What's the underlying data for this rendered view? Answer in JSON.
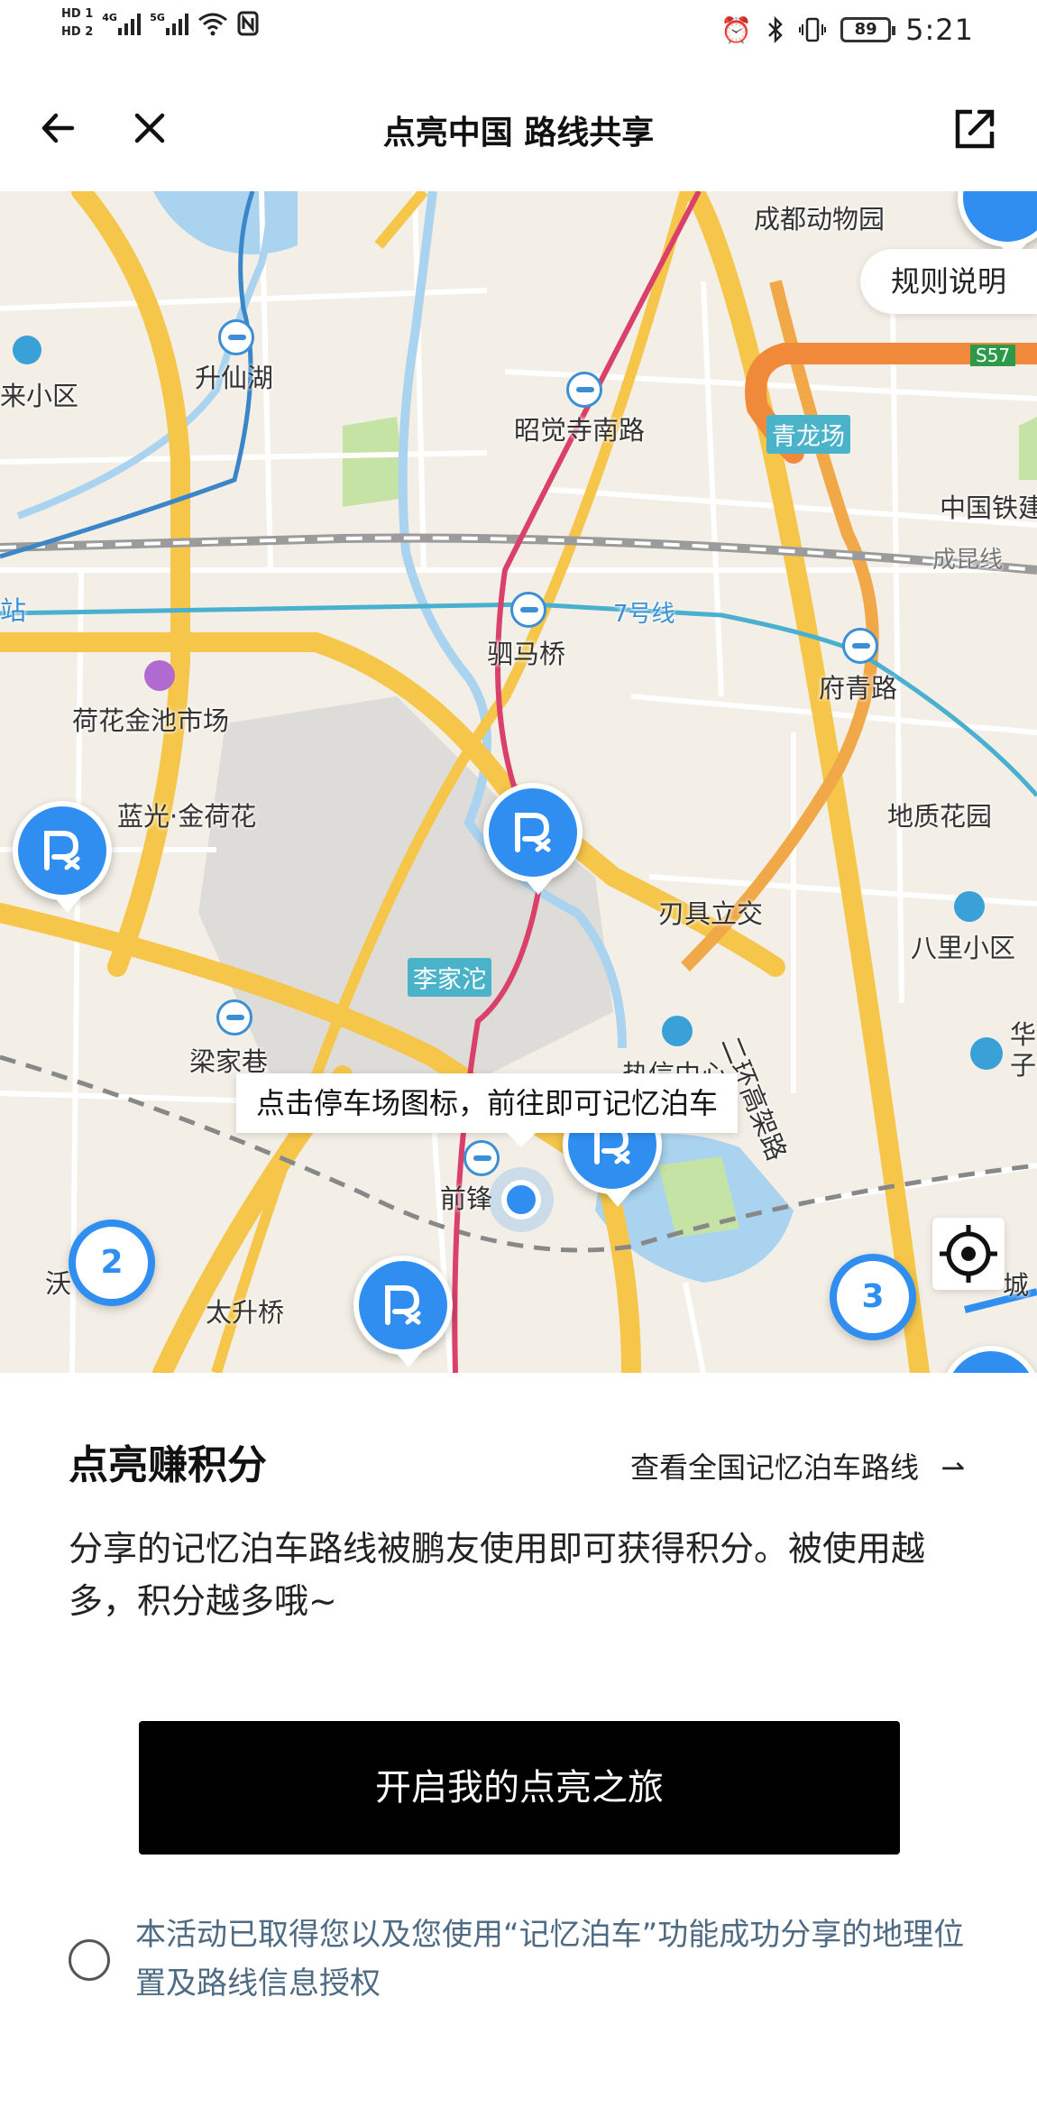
{
  "status_bar": {
    "hd1": "HD 1",
    "hd2": "HD 2",
    "net1": "4G",
    "net2": "5G",
    "battery": "89",
    "time": "5:21"
  },
  "header": {
    "title": "点亮中国 路线共享"
  },
  "map": {
    "rules_label": "规则说明",
    "tooltip": "点击停车场图标，前往即可记忆泊车",
    "labels": {
      "chengdu_zoo": "成都动物园",
      "shengxian_lake": "升仙湖",
      "lai_xiaoqu": "来小区",
      "zhaojuesi_nanlu": "昭觉寺南路",
      "zhongguo_tie": "中国铁建",
      "chengkun_line": "成昆线",
      "zhan": "站",
      "line7": "7号线",
      "simaqiao": "驷马桥",
      "fuqing_road": "府青路",
      "hehua_market": "荷花金池市场",
      "languang": "蓝光·金荷花",
      "dizhi_garden": "地质花园",
      "renju_interchange": "刃具立交",
      "bali_xiaoqu": "八里小区",
      "liangjia_xiang": "梁家巷",
      "second_ring": "二环高架路",
      "relay_center": "热信中心",
      "qianfeng": "前锋",
      "taisheng_bridge": "太升桥",
      "wo": "沃",
      "cheng": "城",
      "huazi": "华子",
      "s57": "S57"
    },
    "tags": {
      "qinglongchang": "青龙场",
      "lijiatuo": "李家沱"
    },
    "clusters": [
      "2",
      "3"
    ]
  },
  "panel": {
    "title": "点亮赚积分",
    "view_link": "查看全国记忆泊车路线",
    "view_arrow": "⇀",
    "description": "分享的记忆泊车路线被鹏友使用即可获得积分。被使用越多，积分越多哦~",
    "start_button": "开启我的点亮之旅",
    "agreement": "本活动已取得您以及您使用“记忆泊车”功能成功分享的地理位置及路线信息授权"
  },
  "colors": {
    "accent_blue": "#2f8ef0",
    "button_black": "#000000",
    "agreement_text": "#4f6b84",
    "road_yellow": "#f5c64a",
    "road_orange": "#f0a848",
    "highway_orange": "#f08a3a",
    "water": "#a9d3ef",
    "green": "#c5e3a5"
  },
  "icons": [
    "back-arrow-icon",
    "close-icon",
    "share-icon",
    "locate-icon",
    "parking-icon",
    "alarm-icon",
    "bluetooth-icon",
    "vibrate-icon",
    "wifi-icon",
    "nfc-icon"
  ]
}
